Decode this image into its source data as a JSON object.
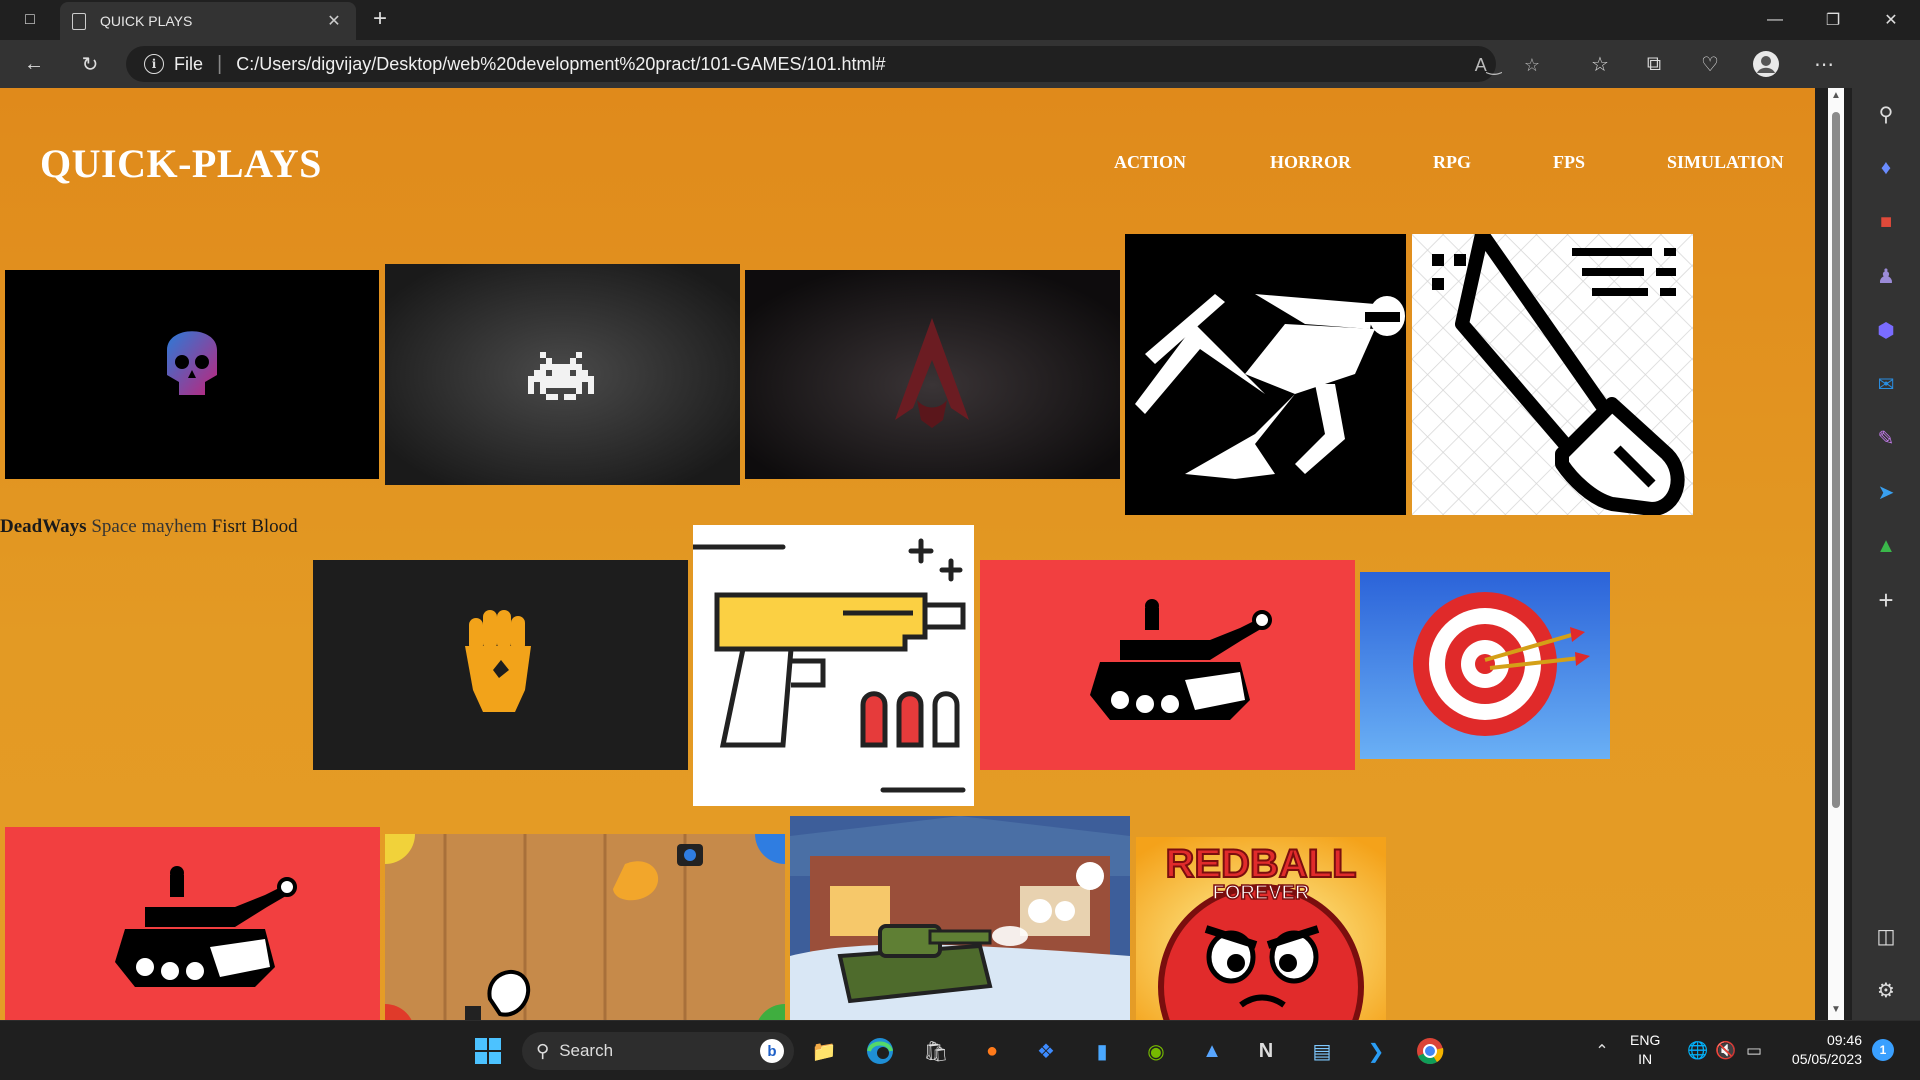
{
  "browser": {
    "tab_title": "QUICK PLAYS",
    "address": {
      "scheme_label": "File",
      "url": "C:/Users/digvijay/Desktop/web%20development%20pract/101-GAMES/101.html#"
    }
  },
  "page": {
    "site_title": "QUICK-PLAYS",
    "nav": [
      "ACTION",
      "HORROR",
      "RPG",
      "FPS",
      "SIMULATION"
    ],
    "caption": {
      "bold": "DeadWays",
      "middle": "Space mayhem",
      "last": "Fisrt Blood"
    },
    "game_tiles": [
      {
        "icon": "skull-logo"
      },
      {
        "icon": "space-invader"
      },
      {
        "icon": "assassin-crest"
      },
      {
        "icon": "running-ninja"
      },
      {
        "icon": "sword-fist"
      },
      {
        "icon": "raised-fist"
      },
      {
        "icon": "pistol"
      },
      {
        "icon": "tank"
      },
      {
        "icon": "target-darts"
      },
      {
        "icon": "tank"
      },
      {
        "icon": "wooden-board"
      },
      {
        "icon": "snow-tank"
      },
      {
        "icon": "red-ball"
      }
    ],
    "redball_text": "REDBALL",
    "redball_sub": "FOREVER"
  },
  "taskbar": {
    "search_label": "Search",
    "lang_top": "ENG",
    "lang_bottom": "IN",
    "time": "09:46",
    "date": "05/05/2023",
    "notification_count": "1"
  },
  "colors": {
    "page_bg": "#e08a1b",
    "tank_bg": "#f23f40",
    "browser_chrome": "#333333"
  }
}
